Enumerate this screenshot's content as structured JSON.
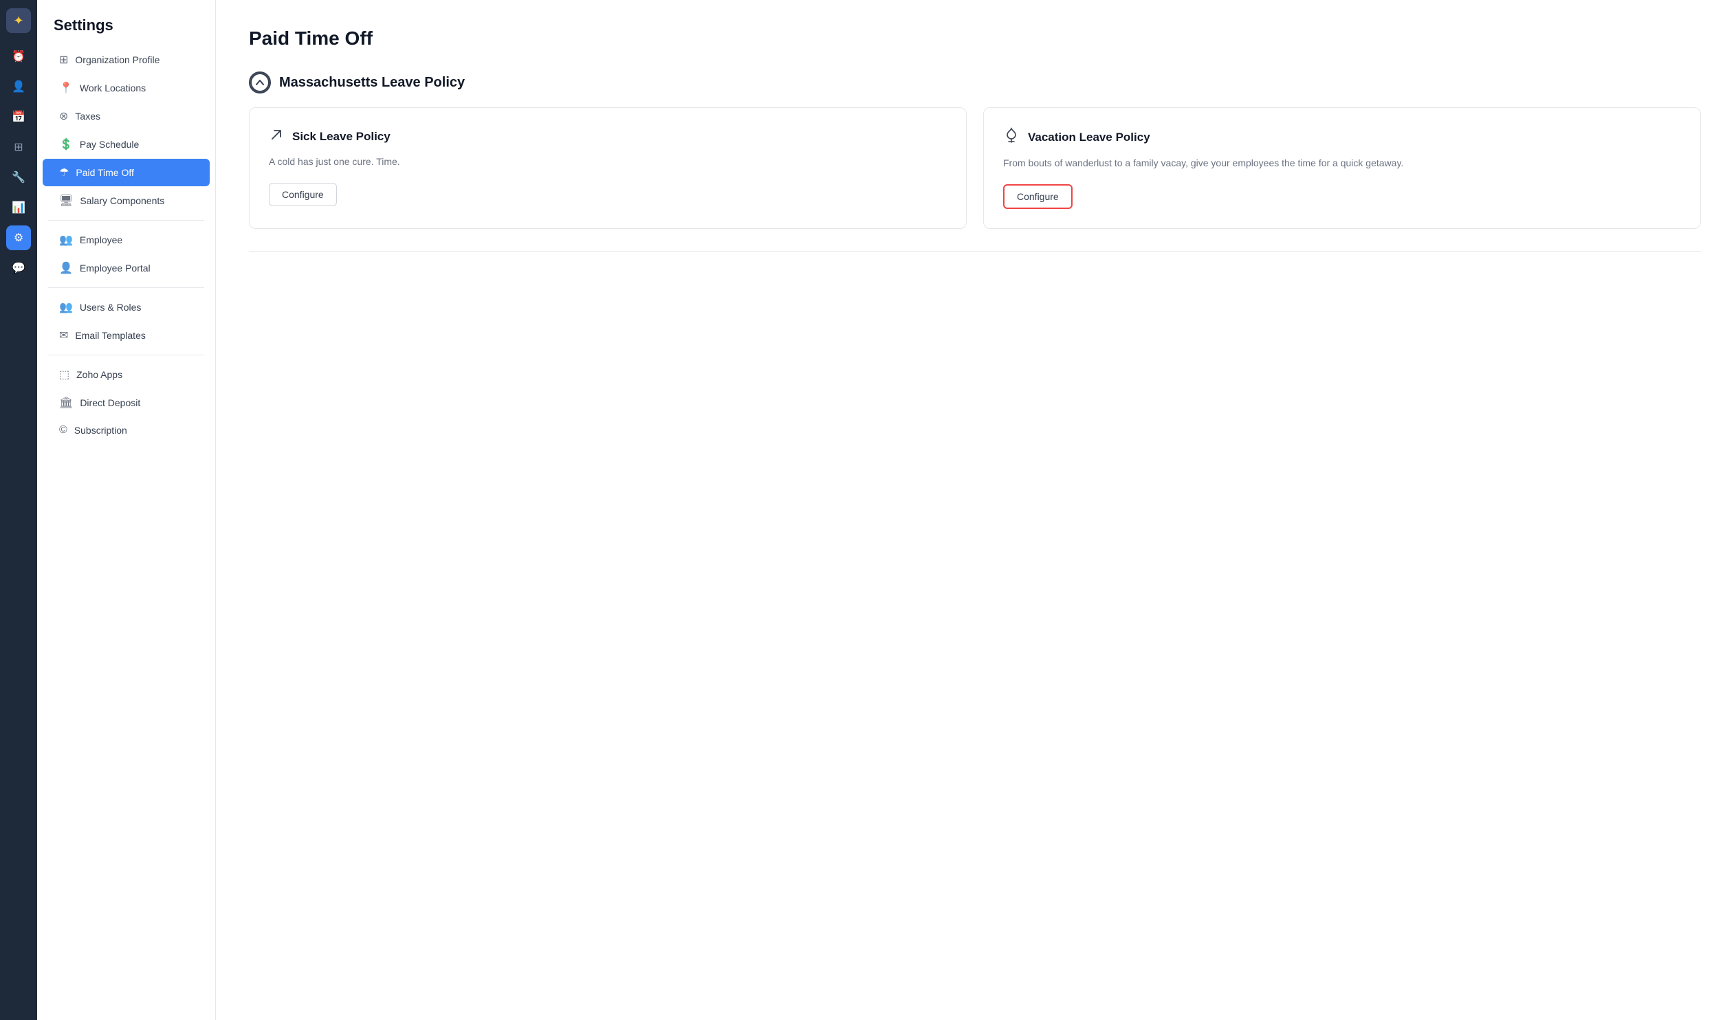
{
  "app": {
    "logo_icon": "✦"
  },
  "icon_bar": {
    "items": [
      {
        "name": "clock-icon",
        "icon": "⏰",
        "active": false
      },
      {
        "name": "person-icon",
        "icon": "👤",
        "active": false
      },
      {
        "name": "calendar-icon",
        "icon": "📅",
        "active": false
      },
      {
        "name": "grid-icon",
        "icon": "⊞",
        "active": false
      },
      {
        "name": "tool-icon",
        "icon": "🔧",
        "active": false
      },
      {
        "name": "chart-icon",
        "icon": "📊",
        "active": false
      },
      {
        "name": "settings-icon",
        "icon": "⚙",
        "active": true
      },
      {
        "name": "chat-icon",
        "icon": "💬",
        "active": false
      }
    ]
  },
  "sidebar": {
    "title": "Settings",
    "items": [
      {
        "id": "org-profile",
        "label": "Organization Profile",
        "icon": "🏢",
        "active": false
      },
      {
        "id": "work-locations",
        "label": "Work Locations",
        "icon": "📍",
        "active": false
      },
      {
        "id": "taxes",
        "label": "Taxes",
        "icon": "⊗",
        "active": false
      },
      {
        "id": "pay-schedule",
        "label": "Pay Schedule",
        "icon": "💲",
        "active": false
      },
      {
        "id": "paid-time-off",
        "label": "Paid Time Off",
        "icon": "☂",
        "active": true
      },
      {
        "id": "salary-components",
        "label": "Salary Components",
        "icon": "🖥",
        "active": false
      }
    ],
    "items2": [
      {
        "id": "employee",
        "label": "Employee",
        "icon": "👥",
        "active": false
      },
      {
        "id": "employee-portal",
        "label": "Employee Portal",
        "icon": "👤+",
        "active": false
      }
    ],
    "items3": [
      {
        "id": "users-roles",
        "label": "Users & Roles",
        "icon": "👥",
        "active": false
      },
      {
        "id": "email-templates",
        "label": "Email Templates",
        "icon": "✉",
        "active": false
      }
    ],
    "items4": [
      {
        "id": "zoho-apps",
        "label": "Zoho Apps",
        "icon": "⬚",
        "active": false
      },
      {
        "id": "direct-deposit",
        "label": "Direct Deposit",
        "icon": "🏛",
        "active": false
      },
      {
        "id": "subscription",
        "label": "Subscription",
        "icon": "©",
        "active": false
      }
    ]
  },
  "page": {
    "title": "Paid Time Off",
    "policy_section": {
      "header_icon": "▲",
      "header_title": "Massachusetts Leave Policy",
      "cards": [
        {
          "id": "sick-leave",
          "icon": "✏",
          "title": "Sick Leave Policy",
          "description": "A cold has just one cure. Time.",
          "button_label": "Configure",
          "highlighted": false
        },
        {
          "id": "vacation-leave",
          "icon": "🍸",
          "title": "Vacation Leave Policy",
          "description": "From bouts of wanderlust to a family vacay, give your employees the time for a quick getaway.",
          "button_label": "Configure",
          "highlighted": true
        }
      ]
    }
  }
}
